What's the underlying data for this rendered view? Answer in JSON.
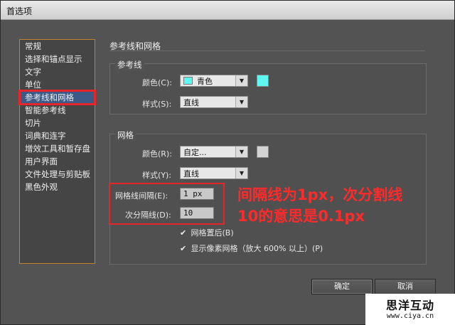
{
  "window": {
    "title": "首选项"
  },
  "categories": [
    {
      "label": "常规"
    },
    {
      "label": "选择和锚点显示"
    },
    {
      "label": "文字"
    },
    {
      "label": "单位"
    },
    {
      "label": "参考线和网格",
      "selected": true
    },
    {
      "label": "智能参考线"
    },
    {
      "label": "切片"
    },
    {
      "label": "词典和连字"
    },
    {
      "label": "增效工具和暂存盘"
    },
    {
      "label": "用户界面"
    },
    {
      "label": "文件处理与剪贴板"
    },
    {
      "label": "黑色外观"
    }
  ],
  "panel": {
    "title": "参考线和网格"
  },
  "guides": {
    "group_label": "参考线",
    "color_label": "颜色(C):",
    "color_value": "青色",
    "color_hex": "#5ef7f2",
    "style_label": "样式(S):",
    "style_value": "直线"
  },
  "grid": {
    "group_label": "网格",
    "color_label": "颜色(R):",
    "color_value": "自定...",
    "color_hex": "#d4d4d4",
    "style_label": "样式(Y):",
    "style_value": "直线",
    "gridline_label": "网格线间隔(E):",
    "gridline_value": "1 px",
    "subdiv_label": "次分隔线(D):",
    "subdiv_value": "10",
    "grids_in_back_label": "网格置后(B)",
    "grids_in_back_checked": true,
    "pixel_grid_label": "显示像素网格（放大 600% 以上）(P)",
    "pixel_grid_checked": true
  },
  "annotation": {
    "line1": "间隔线为1px，次分割线",
    "line2": "10的意思是0.1px",
    "color": "#ff2a2a"
  },
  "buttons": {
    "ok": "确定",
    "cancel": "取消"
  },
  "watermark": {
    "name": "思洋互动",
    "url": "www.ciya.cn"
  }
}
